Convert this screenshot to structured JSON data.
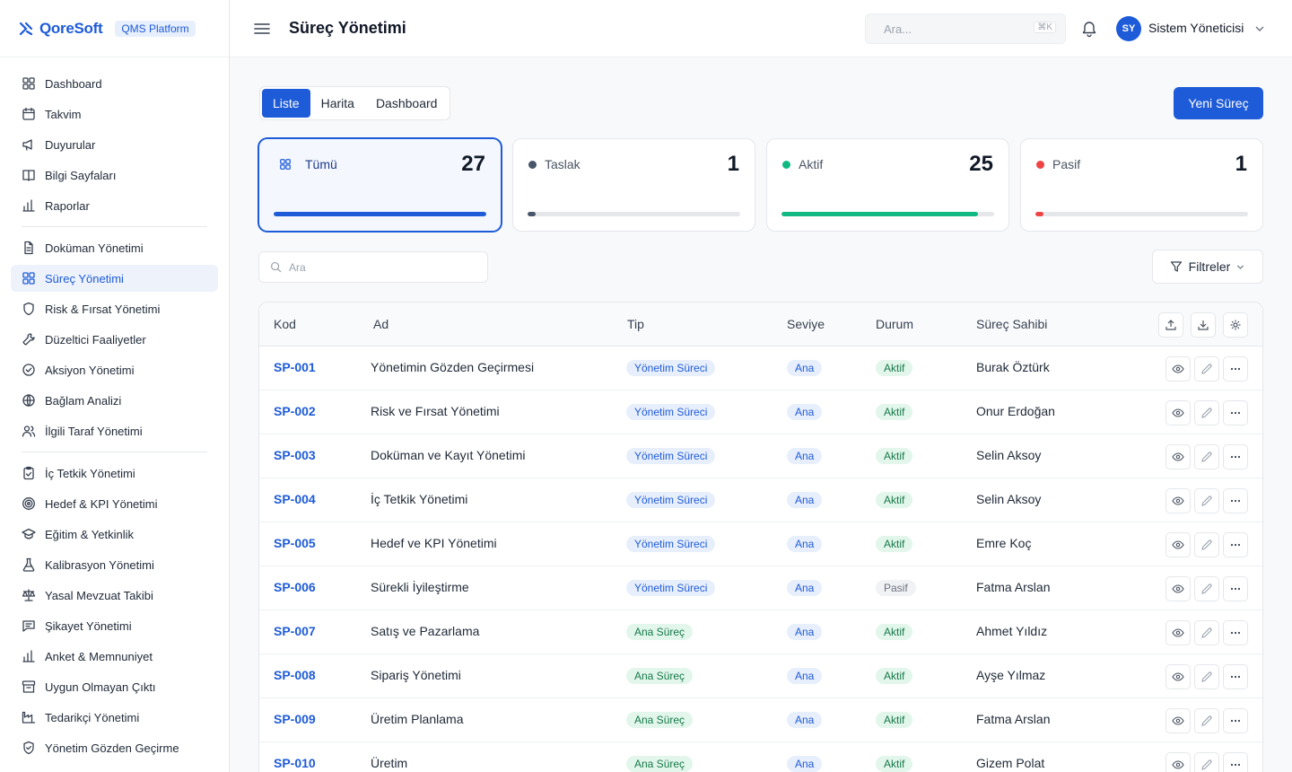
{
  "brand": {
    "name": "QoreSoft",
    "badge": "QMS Platform",
    "logo_icon": "logo-mark-icon"
  },
  "sidebar": {
    "groups": [
      [
        {
          "label": "Dashboard",
          "icon": "grid-icon"
        },
        {
          "label": "Takvim",
          "icon": "calendar-icon"
        },
        {
          "label": "Duyurular",
          "icon": "megaphone-icon"
        },
        {
          "label": "Bilgi Sayfaları",
          "icon": "book-icon"
        },
        {
          "label": "Raporlar",
          "icon": "bar-chart-icon"
        }
      ],
      [
        {
          "label": "Doküman Yönetimi",
          "icon": "document-icon"
        },
        {
          "label": "Süreç Yönetimi",
          "icon": "grid-icon",
          "active": true
        },
        {
          "label": "Risk & Fırsat Yönetimi",
          "icon": "shield-icon"
        },
        {
          "label": "Düzeltici Faaliyetler",
          "icon": "wrench-icon"
        },
        {
          "label": "Aksiyon Yönetimi",
          "icon": "check-circle-icon"
        },
        {
          "label": "Bağlam Analizi",
          "icon": "globe-icon"
        },
        {
          "label": "İlgili Taraf Yönetimi",
          "icon": "users-icon"
        }
      ],
      [
        {
          "label": "İç Tetkik Yönetimi",
          "icon": "clipboard-check-icon"
        },
        {
          "label": "Hedef & KPI Yönetimi",
          "icon": "target-icon"
        },
        {
          "label": "Eğitim & Yetkinlik",
          "icon": "graduation-cap-icon"
        },
        {
          "label": "Kalibrasyon Yönetimi",
          "icon": "flask-icon"
        },
        {
          "label": "Yasal Mevzuat Takibi",
          "icon": "scale-icon"
        },
        {
          "label": "Şikayet Yönetimi",
          "icon": "message-icon"
        },
        {
          "label": "Anket & Memnuniyet",
          "icon": "bar-chart-icon"
        },
        {
          "label": "Uygun Olmayan Çıktı",
          "icon": "archive-icon"
        },
        {
          "label": "Tedarikçi Yönetimi",
          "icon": "factory-icon"
        },
        {
          "label": "Yönetim Gözden Geçirme",
          "icon": "shield-check-icon"
        }
      ]
    ]
  },
  "header": {
    "title": "Süreç Yönetimi",
    "search_placeholder": "Ara...",
    "search_shortcut": "⌘K",
    "user_initials": "SY",
    "user_name": "Sistem Yöneticisi"
  },
  "tabs": [
    {
      "label": "Liste",
      "active": true
    },
    {
      "label": "Harita",
      "active": false
    },
    {
      "label": "Dashboard",
      "active": false
    }
  ],
  "new_button": "Yeni Süreç",
  "stats": [
    {
      "label": "Tümü",
      "count": "27",
      "fraction": 1.0,
      "color": "#1e5bd8",
      "active": true
    },
    {
      "label": "Taslak",
      "count": "1",
      "fraction": 0.037,
      "color": "#475569",
      "active": false
    },
    {
      "label": "Aktif",
      "count": "25",
      "fraction": 0.926,
      "color": "#10b981",
      "active": false
    },
    {
      "label": "Pasif",
      "count": "1",
      "fraction": 0.037,
      "color": "#ef4444",
      "active": false
    }
  ],
  "search_placeholder": "Ara",
  "filter_label": "Filtreler",
  "table": {
    "columns": [
      "Kod",
      "Ad",
      "Tip",
      "Seviye",
      "Durum",
      "Süreç Sahibi"
    ],
    "rows": [
      {
        "code": "SP-001",
        "name": "Yönetimin Gözden Geçirmesi",
        "type": "Yönetim Süreci",
        "level": "Ana",
        "status": "Aktif",
        "owner": "Burak Öztürk"
      },
      {
        "code": "SP-002",
        "name": "Risk ve Fırsat Yönetimi",
        "type": "Yönetim Süreci",
        "level": "Ana",
        "status": "Aktif",
        "owner": "Onur Erdoğan"
      },
      {
        "code": "SP-003",
        "name": "Doküman ve Kayıt Yönetimi",
        "type": "Yönetim Süreci",
        "level": "Ana",
        "status": "Aktif",
        "owner": "Selin Aksoy"
      },
      {
        "code": "SP-004",
        "name": "İç Tetkik Yönetimi",
        "type": "Yönetim Süreci",
        "level": "Ana",
        "status": "Aktif",
        "owner": "Selin Aksoy"
      },
      {
        "code": "SP-005",
        "name": "Hedef ve KPI Yönetimi",
        "type": "Yönetim Süreci",
        "level": "Ana",
        "status": "Aktif",
        "owner": "Emre Koç"
      },
      {
        "code": "SP-006",
        "name": "Sürekli İyileştirme",
        "type": "Yönetim Süreci",
        "level": "Ana",
        "status": "Pasif",
        "owner": "Fatma Arslan"
      },
      {
        "code": "SP-007",
        "name": "Satış ve Pazarlama",
        "type": "Ana Süreç",
        "level": "Ana",
        "status": "Aktif",
        "owner": "Ahmet Yıldız"
      },
      {
        "code": "SP-008",
        "name": "Sipariş Yönetimi",
        "type": "Ana Süreç",
        "level": "Ana",
        "status": "Aktif",
        "owner": "Ayşe Yılmaz"
      },
      {
        "code": "SP-009",
        "name": "Üretim Planlama",
        "type": "Ana Süreç",
        "level": "Ana",
        "status": "Aktif",
        "owner": "Fatma Arslan"
      },
      {
        "code": "SP-010",
        "name": "Üretim",
        "type": "Ana Süreç",
        "level": "Ana",
        "status": "Aktif",
        "owner": "Gizem Polat"
      }
    ]
  }
}
